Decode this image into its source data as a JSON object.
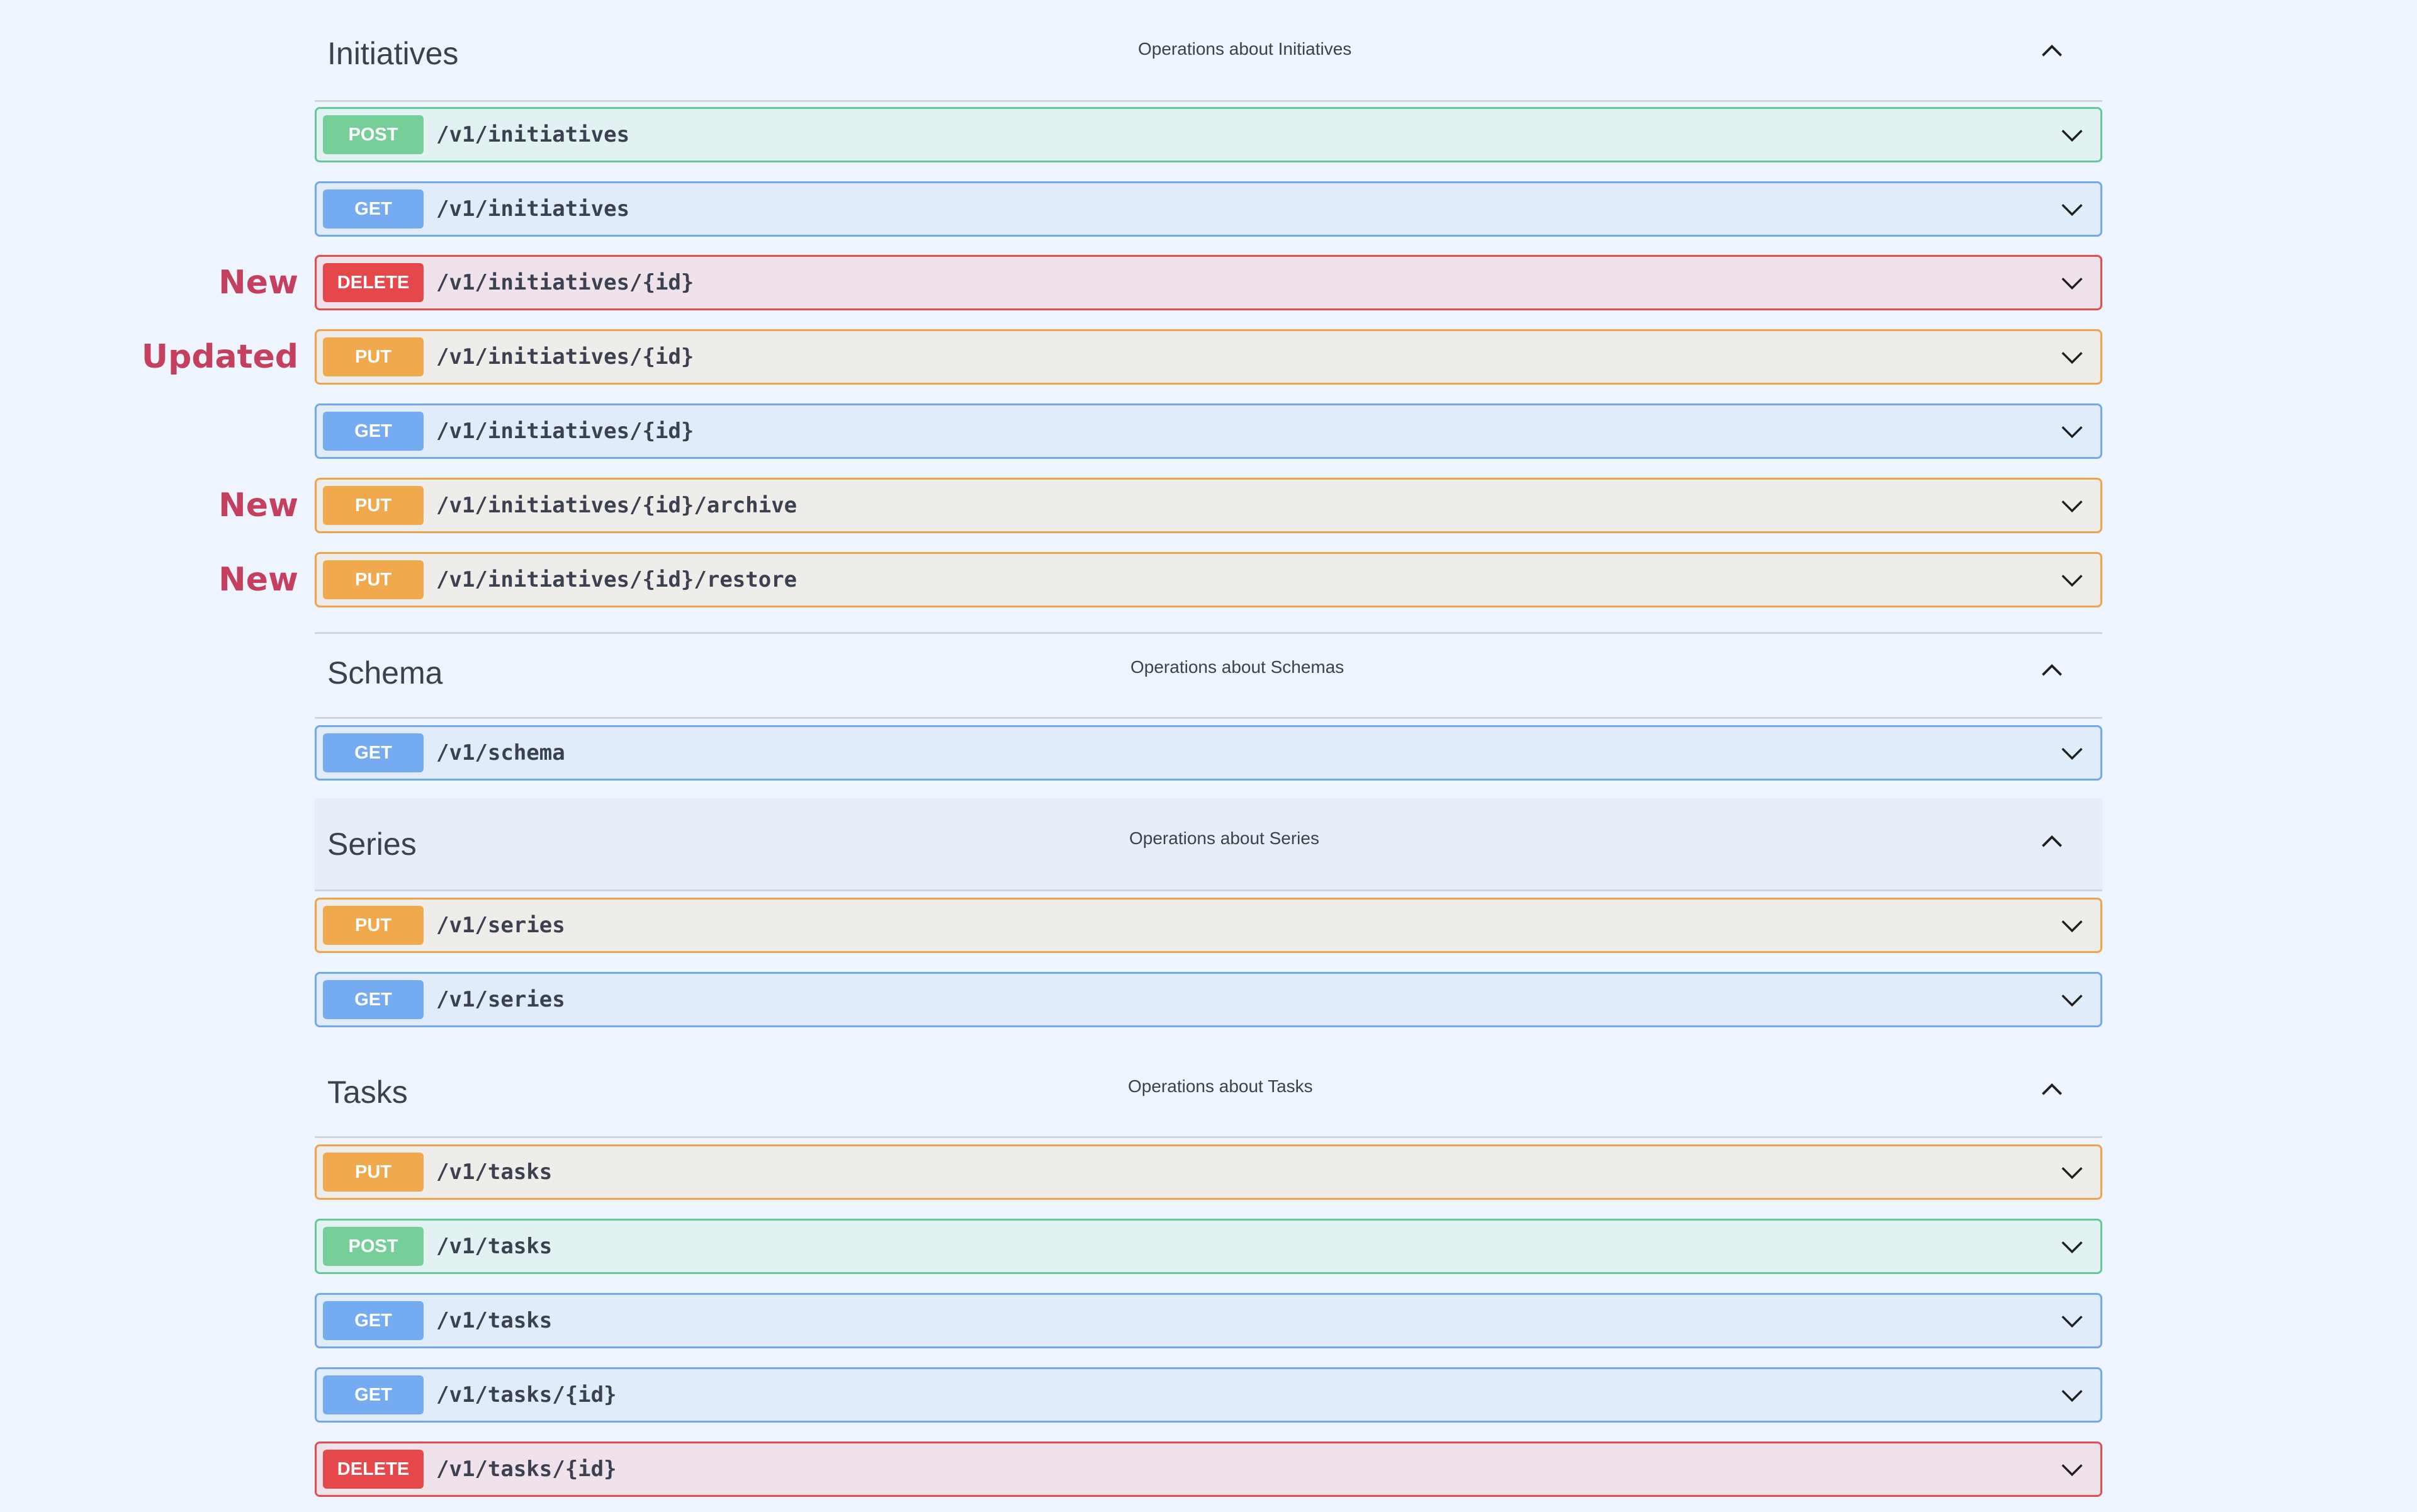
{
  "sections": [
    {
      "title": "Initiatives",
      "description": "Operations about Initiatives",
      "toggle_icon": "chevron-up-icon",
      "operations": [
        {
          "method": "POST",
          "path": "/v1/initiatives",
          "note": ""
        },
        {
          "method": "GET",
          "path": "/v1/initiatives",
          "note": ""
        },
        {
          "method": "DELETE",
          "path": "/v1/initiatives/{id}",
          "note": "New"
        },
        {
          "method": "PUT",
          "path": "/v1/initiatives/{id}",
          "note": "Updated"
        },
        {
          "method": "GET",
          "path": "/v1/initiatives/{id}",
          "note": ""
        },
        {
          "method": "PUT",
          "path": "/v1/initiatives/{id}/archive",
          "note": "New"
        },
        {
          "method": "PUT",
          "path": "/v1/initiatives/{id}/restore",
          "note": "New"
        }
      ]
    },
    {
      "title": "Schema",
      "description": "Operations about Schemas",
      "toggle_icon": "chevron-up-icon",
      "operations": [
        {
          "method": "GET",
          "path": "/v1/schema",
          "note": ""
        }
      ]
    },
    {
      "title": "Series",
      "description": "Operations about Series",
      "toggle_icon": "chevron-up-icon",
      "operations": [
        {
          "method": "PUT",
          "path": "/v1/series",
          "note": ""
        },
        {
          "method": "GET",
          "path": "/v1/series",
          "note": ""
        }
      ]
    },
    {
      "title": "Tasks",
      "description": "Operations about Tasks",
      "toggle_icon": "chevron-up-icon",
      "operations": [
        {
          "method": "PUT",
          "path": "/v1/tasks",
          "note": ""
        },
        {
          "method": "POST",
          "path": "/v1/tasks",
          "note": ""
        },
        {
          "method": "GET",
          "path": "/v1/tasks",
          "note": ""
        },
        {
          "method": "GET",
          "path": "/v1/tasks/{id}",
          "note": ""
        },
        {
          "method": "DELETE",
          "path": "/v1/tasks/{id}",
          "note": ""
        }
      ]
    }
  ],
  "colors": {
    "post": "#76cf98",
    "get": "#75acf1",
    "put": "#f1a94e",
    "delete": "#e5484a",
    "note": "#c53f5e",
    "background": "#eef5fe"
  }
}
